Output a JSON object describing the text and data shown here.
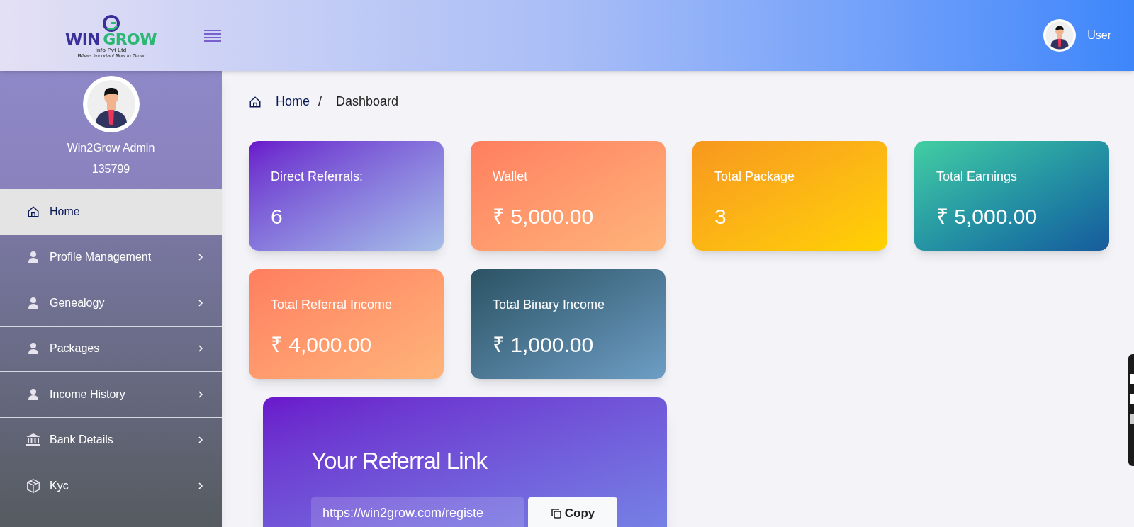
{
  "header": {
    "logo": {
      "name_left": "WIN",
      "name_right": "GROW",
      "company": "Info Pvt Ltd",
      "tagline": "**W**hats **I**mportant **N**ow to **G**row"
    },
    "user_label": "User"
  },
  "sidebar": {
    "profile": {
      "name": "Win2Grow Admin",
      "id": "135799"
    },
    "items": [
      {
        "label": "Home",
        "kind": "home",
        "selected": true,
        "has_submenu": false
      },
      {
        "label": "Profile Management",
        "kind": "user",
        "selected": false,
        "has_submenu": true
      },
      {
        "label": "Genealogy",
        "kind": "user",
        "selected": false,
        "has_submenu": true
      },
      {
        "label": "Packages",
        "kind": "user",
        "selected": false,
        "has_submenu": true
      },
      {
        "label": "Income History",
        "kind": "user",
        "selected": false,
        "has_submenu": true
      },
      {
        "label": "Bank Details",
        "kind": "bank",
        "selected": false,
        "has_submenu": true
      },
      {
        "label": "Kyc",
        "kind": "box",
        "selected": false,
        "has_submenu": true
      }
    ]
  },
  "breadcrumb": {
    "home": "Home",
    "separator": "/",
    "current": "Dashboard"
  },
  "stat_cards": [
    {
      "title": "Direct Referrals:",
      "value": "6"
    },
    {
      "title": "Wallet",
      "value": "₹ 5,000.00"
    },
    {
      "title": "Total Package",
      "value": "3"
    },
    {
      "title": "Total Earnings",
      "value": "₹ 5,000.00"
    },
    {
      "title": "Total Referral Income",
      "value": "₹ 4,000.00"
    },
    {
      "title": "Total Binary Income",
      "value": "₹ 1,000.00"
    }
  ],
  "referral": {
    "title": "Your Referral Link",
    "link": "https://win2grow.com/registe",
    "button": "Copy"
  }
}
